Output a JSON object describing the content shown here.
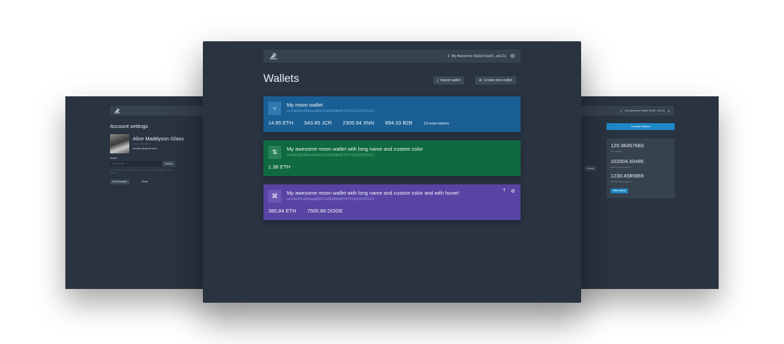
{
  "account_panel": {
    "title": "Account settings",
    "name": "Alice Maddyson Glass",
    "subtitle": "Here is sth sublime",
    "email": "iamalice@gmail.com",
    "avatar_label": "Avatar",
    "file_placeholder": "Choose file...",
    "browse_label": "Browse",
    "help_text": "Your avatar is projected and will be used for cloud identification in the wallet list",
    "save_label": "Save changes",
    "reset_label": "Reset"
  },
  "detail_panel": {
    "account_label": "My Awesome Wallet 0xa0f...ab12a",
    "transfer_label": "Transfer tokens",
    "details_label": "Details",
    "balances": [
      {
        "value": "120.38457683",
        "caption": "ETH balance"
      },
      {
        "value": "102004.50495",
        "caption": "ERC20 token balance"
      },
      {
        "value": "1230.4585869",
        "caption": "ERC223 token balance"
      }
    ],
    "deposit_label": "Make deposit"
  },
  "header": {
    "account_label": "My Awesome Wallet 0xa0f...ab12a"
  },
  "page": {
    "title": "Wallets",
    "import_label": "Import wallet",
    "create_label": "Create new wallet"
  },
  "wallets": [
    {
      "name": "My moon wallet",
      "address": "0x2AE99c889ea685F314fE88fb80787F1E5000f31D1",
      "color": "#1a5f94",
      "icon_bg": "#2f79b0",
      "addr_color": "#5fa6da",
      "icon": "fork-icon",
      "balances": [
        "14.85 ETH",
        "543.85 JCR",
        "2305.94 XNN",
        "894.33 B2B"
      ],
      "more": "13 more tokens"
    },
    {
      "name": "My awesome moon wallet with long name and custom color",
      "address": "0x2AE99c889ea685F314fE88fb80787F1E5000f31D1",
      "color": "#0f6a3f",
      "icon_bg": "#2a8157",
      "addr_color": "#59b686",
      "icon": "pull-request-icon",
      "balances": [
        "1.38 ETH"
      ],
      "more": ""
    },
    {
      "name": "My awesome moon wallet with long name and custom color and with hover!",
      "address": "0x2AE99c889ea685F314fE88fb80787F1E5000f31D1",
      "color": "#5744a3",
      "icon_bg": "#6a58b4",
      "addr_color": "#a596e2",
      "icon": "command-icon",
      "balances": [
        "385.84 ETH",
        "7500.88 DOGE"
      ],
      "more": ""
    }
  ]
}
